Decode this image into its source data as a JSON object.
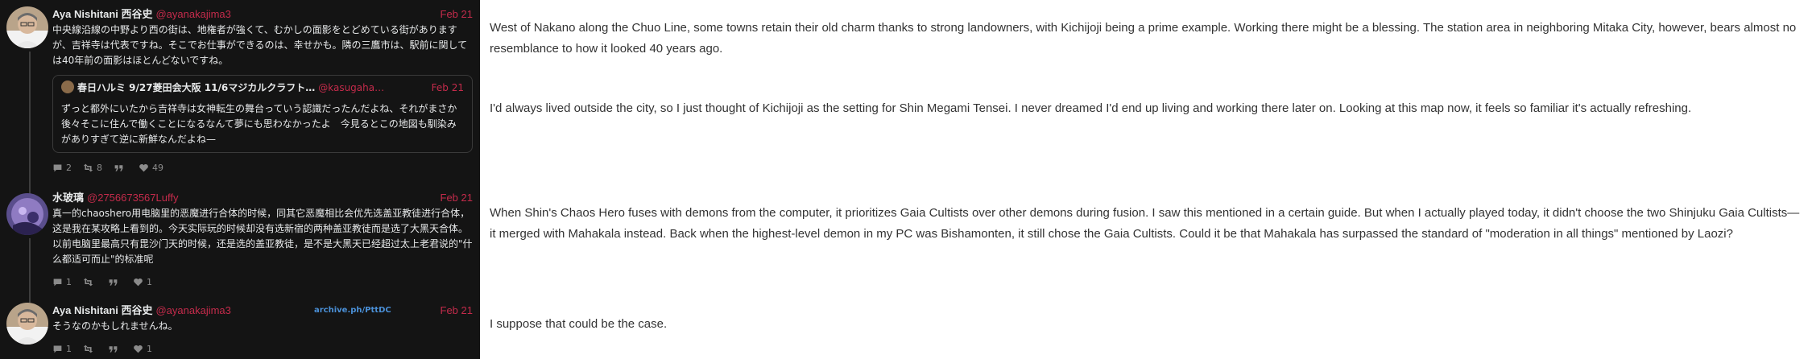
{
  "posts": [
    {
      "name": "Aya Nishitani 西谷史",
      "handle": "@ayanakajima3",
      "date": "Feb 21",
      "text": "中央線沿線の中野より西の街は、地権者が強くて、むかしの面影をとどめている街がありますが、吉祥寺は代表ですね。そこでお仕事ができるのは、幸せかも。隣の三鷹市は、駅前に関しては40年前の面影はほとんどないですね。",
      "quote": {
        "name": "春日ハルミ 9/27菱田会大阪 11/6マジカルクラフト…",
        "handle": "@kasugaha…",
        "date": "Feb 21",
        "text": "ずっと都外にいたから吉祥寺は女神転生の舞台っていう認識だったんだよね、それがまさか後々そこに住んで働くことになるなんて夢にも思わなかったよ　今見るとこの地図も馴染みがありすぎて逆に新鮮なんだよね—"
      },
      "actions": {
        "replies": "2",
        "reposts": "8",
        "quotes": "",
        "likes": "49"
      }
    },
    {
      "name": "水玻璃",
      "handle": "@2756673567Luffy",
      "date": "Feb 21",
      "text": "真一的chaoshero用电脑里的恶魔进行合体的时候，同其它恶魔相比会优先选盖亚教徒进行合体，这是我在某攻略上看到的。今天实际玩的时候却没有选新宿的两种盖亚教徒而是选了大黑天合体。以前电脑里最高只有毘沙门天的时候，还是选的盖亚教徒，是不是大黑天已经超过太上老君说的\"什么都适可而止\"的标准呢",
      "actions": {
        "replies": "1",
        "reposts": "",
        "quotes": "",
        "likes": "1"
      }
    },
    {
      "name": "Aya Nishitani 西谷史",
      "handle": "@ayanakajima3",
      "date": "Feb 21",
      "archive": "archive.ph/PttDC",
      "text": "そうなのかもしれませんね。",
      "actions": {
        "replies": "1",
        "reposts": "",
        "quotes": "",
        "likes": "1"
      }
    }
  ],
  "translations": [
    "West of Nakano along the Chuo Line, some towns retain their old charm thanks to strong landowners, with Kichijoji being a prime example. Working there might be a blessing. The station area in neighboring Mitaka City, however, bears almost no resemblance to how it looked 40 years ago.",
    "I'd always lived outside the city, so I just thought of Kichijoji as the setting for Shin Megami Tensei. I never dreamed I'd end up living and working there later on. Looking at this map now, it feels so familiar it's actually refreshing.",
    "When Shin's Chaos Hero fuses with demons from the computer, it prioritizes Gaia Cultists over other demons during fusion. I saw this mentioned in a certain guide. But when I actually played today, it didn't choose the two Shinjuku Gaia Cultists—it merged with Mahakala instead. Back when the highest-level demon in my PC was Bishamonten, it still chose the Gaia Cultists. Could it be that Mahakala has surpassed the standard of \"moderation in all things\" mentioned by Laozi?",
    "I suppose that could be the case."
  ],
  "colors": {
    "panel_bg": "#141414",
    "accent": "#c42b4b",
    "link": "#4a8fd6",
    "muted": "#8b8b8b"
  },
  "icons": [
    "reply-icon",
    "repost-icon",
    "quote-icon",
    "like-icon"
  ]
}
